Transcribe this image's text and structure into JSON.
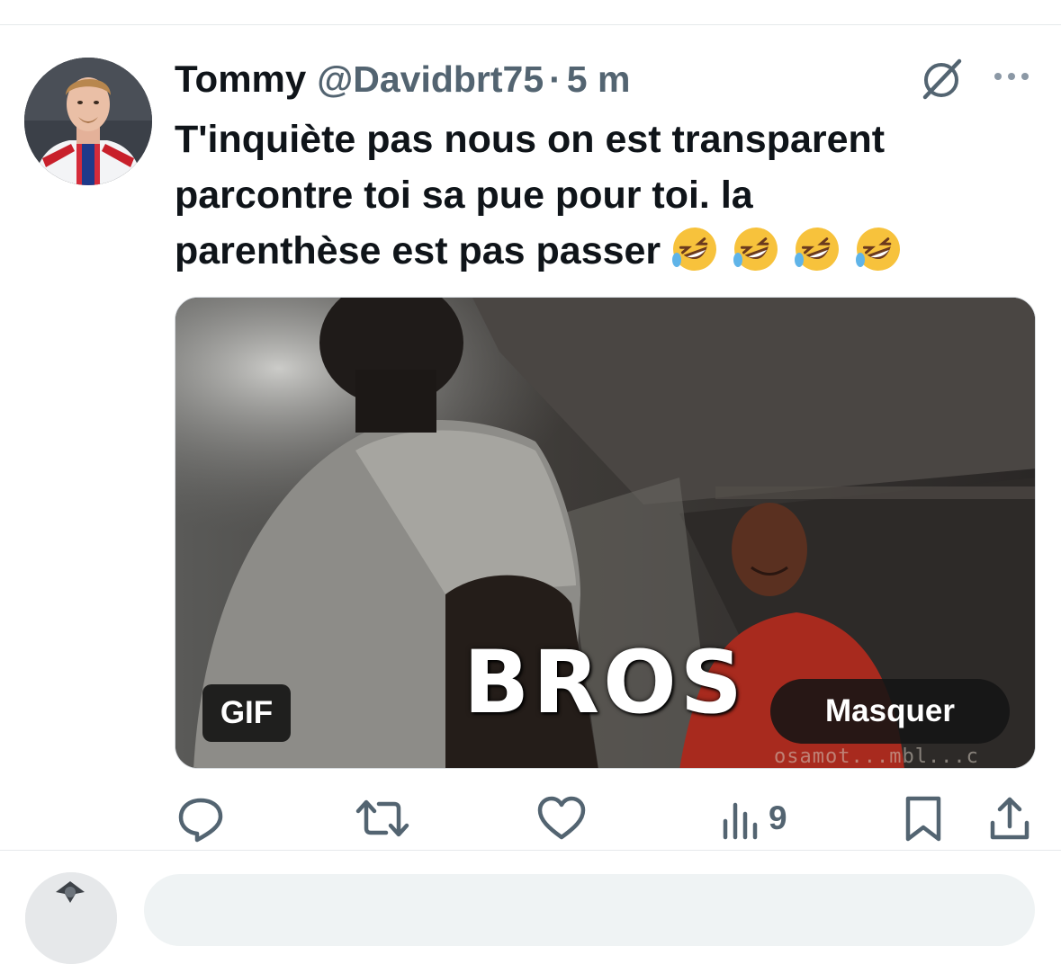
{
  "tweet": {
    "author_name": "Tommy",
    "handle": "@Davidbrt75",
    "separator": "·",
    "time": "5 m",
    "text_lines": [
      "T'inquiète pas nous on est transparent",
      "parcontre toi sa pue pour toi. la",
      "parenthèse est pas passer"
    ],
    "emojis": [
      "🤣",
      "🤣",
      "🤣",
      "🤣"
    ],
    "header_icons": [
      "grok-icon",
      "more-icon"
    ]
  },
  "media": {
    "overlay_text": "BROS",
    "badge": "GIF",
    "hide_button": "Masquer",
    "watermark": "osamot...mbl...c"
  },
  "actions": {
    "reply_icon": "reply-icon",
    "retweet_icon": "retweet-icon",
    "like_icon": "heart-icon",
    "views_icon": "views-icon",
    "views_count": "9",
    "bookmark_icon": "bookmark-icon",
    "share_icon": "share-icon"
  },
  "colors": {
    "text": "#0f1419",
    "secondary": "#536471",
    "divider": "#e6e9eb"
  }
}
